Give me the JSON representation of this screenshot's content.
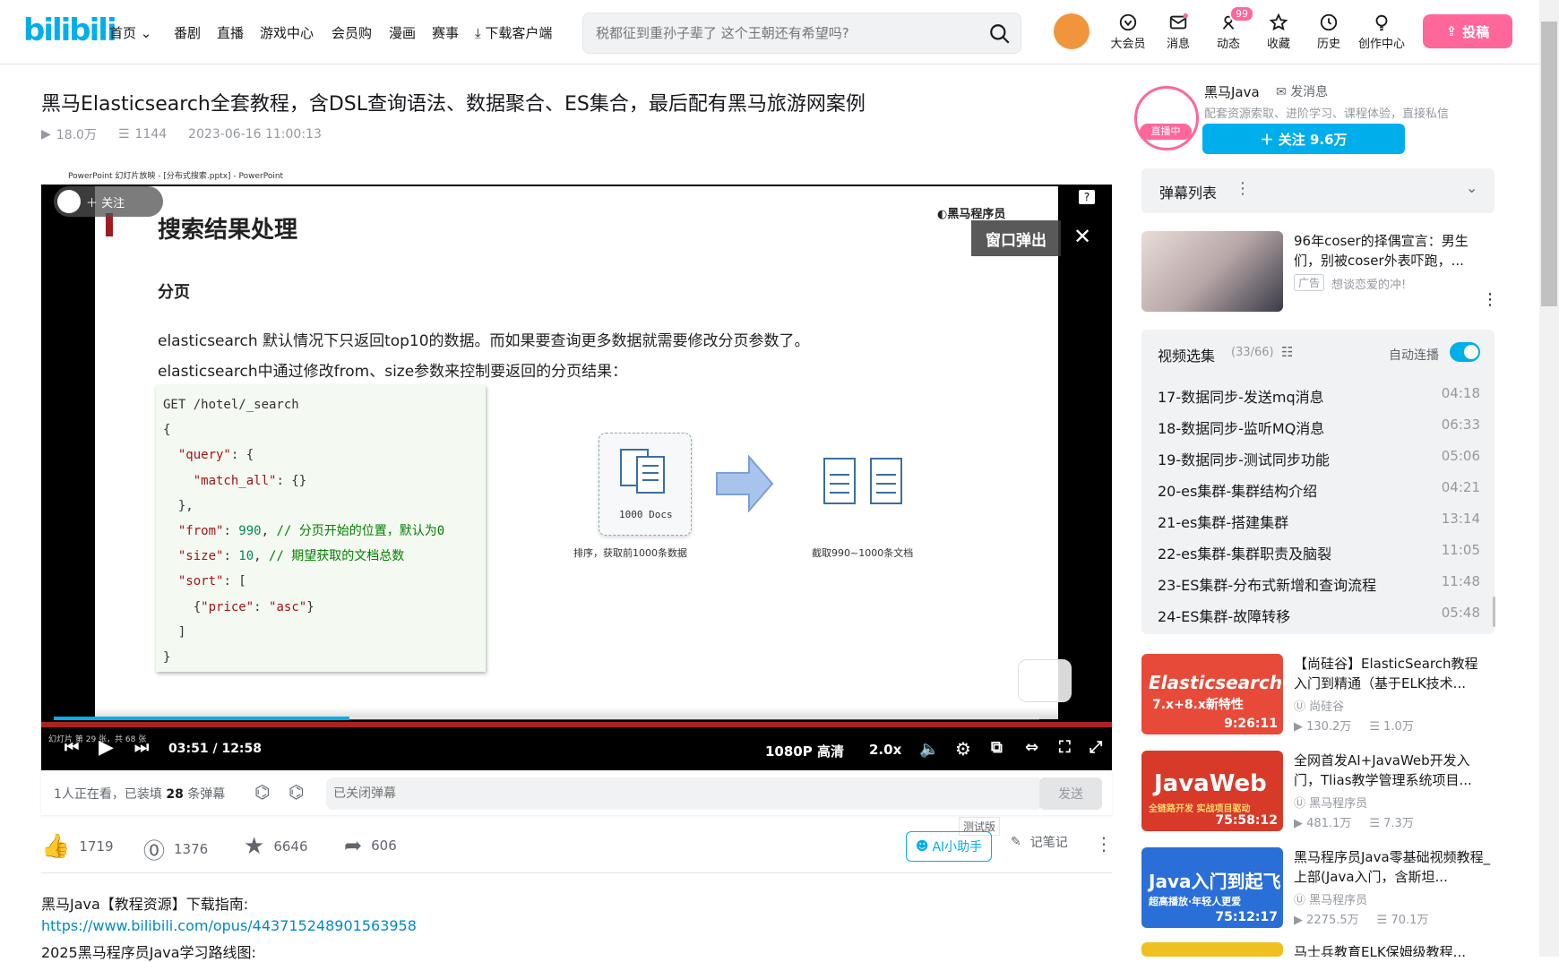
{
  "header": {
    "logo": "bilibili",
    "nav": [
      "首页",
      "番剧",
      "直播",
      "游戏中心",
      "会员购",
      "漫画",
      "赛事",
      "下载客户端"
    ],
    "search_placeholder": "税都征到重孙子辈了 这个王朝还有希望吗?",
    "icons": [
      {
        "label": "大会员",
        "icon": "vip-icon"
      },
      {
        "label": "消息",
        "icon": "message-icon"
      },
      {
        "label": "动态",
        "icon": "dynamic-icon"
      },
      {
        "label": "收藏",
        "icon": "star-icon"
      },
      {
        "label": "历史",
        "icon": "history-icon"
      },
      {
        "label": "创作中心",
        "icon": "bulb-icon"
      }
    ],
    "badge": "99",
    "upload": "投稿",
    "accent": "#00aeec",
    "pink": "#ff6699"
  },
  "video": {
    "title": "黑马Elasticsearch全套教程，含DSL查询语法、数据聚合、ES集合，最后配有黑马旅游网案例",
    "views": "18.0万",
    "danmaku": "1144",
    "date": "2023-06-16 11:00:13"
  },
  "player": {
    "ppt_title": "PowerPoint 幻灯片放映 - [分布式搜索.pptx] - PowerPoint",
    "follow": "关注",
    "popout": "窗口弹出",
    "slide_title": "搜索结果处理",
    "slide_brand": "黑马程序员",
    "slide_subtitle": "分页",
    "para1": "elasticsearch 默认情况下只返回top10的数据。而如果要查询更多数据就需要修改分页参数了。",
    "para2": "elasticsearch中通过修改from、size参数来控制要返回的分页结果：",
    "docs_label": "1000 Docs",
    "caption_left": "排序，获取前1000条数据",
    "caption_right": "截取990~1000条文档",
    "slide_no": "幻灯片 第 29 张，共 68 张",
    "time_current": "03:51",
    "time_total": "12:58",
    "quality": "1080P 高清",
    "speed": "2.0x",
    "progress": 0.3
  },
  "danmaku_bar": {
    "viewing_prefix": "1人正在看，已装填",
    "count": "28",
    "viewing_suffix": "条弹幕",
    "placeholder": "已关闭弹幕",
    "send": "发送"
  },
  "actions": {
    "like": "1719",
    "coin": "1376",
    "fav": "6646",
    "share": "606",
    "ai": "AI小助手",
    "beta": "测试版",
    "note": "记笔记"
  },
  "description": {
    "line1": "黑马Java【教程资源】下载指南:",
    "link": "https://www.bilibili.com/opus/443715248901563958",
    "line3": "2025黑马程序员Java学习路线图:"
  },
  "uploader": {
    "name": "黑马Java",
    "msg": "发消息",
    "desc": "配套资源索取、进阶学习、课程体验，直接私信",
    "follow": "关注 9.6万",
    "live": "直播中"
  },
  "danmaku_list": {
    "label": "弹幕列表"
  },
  "ad": {
    "title": "96年coser的择偶宣言：男生们，别被coser外表吓跑，...",
    "tag": "广告",
    "sub": "想谈恋爱的冲!"
  },
  "playlist": {
    "title": "视频选集",
    "count": "(33/66)",
    "autoplay": "自动连播",
    "items": [
      {
        "title": "17-数据同步-发送mq消息",
        "dur": "04:18"
      },
      {
        "title": "18-数据同步-监听MQ消息",
        "dur": "06:33"
      },
      {
        "title": "19-数据同步-测试同步功能",
        "dur": "05:06"
      },
      {
        "title": "20-es集群-集群结构介绍",
        "dur": "04:21"
      },
      {
        "title": "21-es集群-搭建集群",
        "dur": "13:14"
      },
      {
        "title": "22-es集群-集群职责及脑裂",
        "dur": "11:05"
      },
      {
        "title": "23-ES集群-分布式新增和查询流程",
        "dur": "11:48"
      },
      {
        "title": "24-ES集群-故障转移",
        "dur": "05:48"
      }
    ]
  },
  "recommend": [
    {
      "title": "【尚硅谷】ElasticSearch教程入门到精通（基于ELK技术...",
      "up": "尚硅谷",
      "views": "130.2万",
      "dm": "1.0万",
      "dur": "9:26:11",
      "thumb_text": "Elasticsearch",
      "thumb_sub": "7.x+8.x新特性",
      "color": "#e84a3a"
    },
    {
      "title": "全网首发AI+JavaWeb开发入门，Tlias教学管理系统项目...",
      "up": "黑马程序员",
      "views": "481.1万",
      "dm": "7.3万",
      "dur": "75:58:12",
      "thumb_text": "JavaWeb",
      "thumb_sub": "全链路开发 实战项目驱动",
      "color": "#d83a2a"
    },
    {
      "title": "黑马程序员Java零基础视频教程_上部(Java入门，含斯坦...",
      "up": "黑马程序员",
      "views": "2275.5万",
      "dm": "70.1万",
      "dur": "75:12:17",
      "thumb_text": "Java入门到起飞",
      "thumb_sub": "超高播放·年轻人更爱",
      "color": "#2a6fd8"
    },
    {
      "title": "马士兵教育ELK保姆级教程...",
      "up": "",
      "views": "",
      "dm": "",
      "dur": "",
      "thumb_text": "",
      "thumb_sub": "",
      "color": "#f0c020"
    }
  ]
}
